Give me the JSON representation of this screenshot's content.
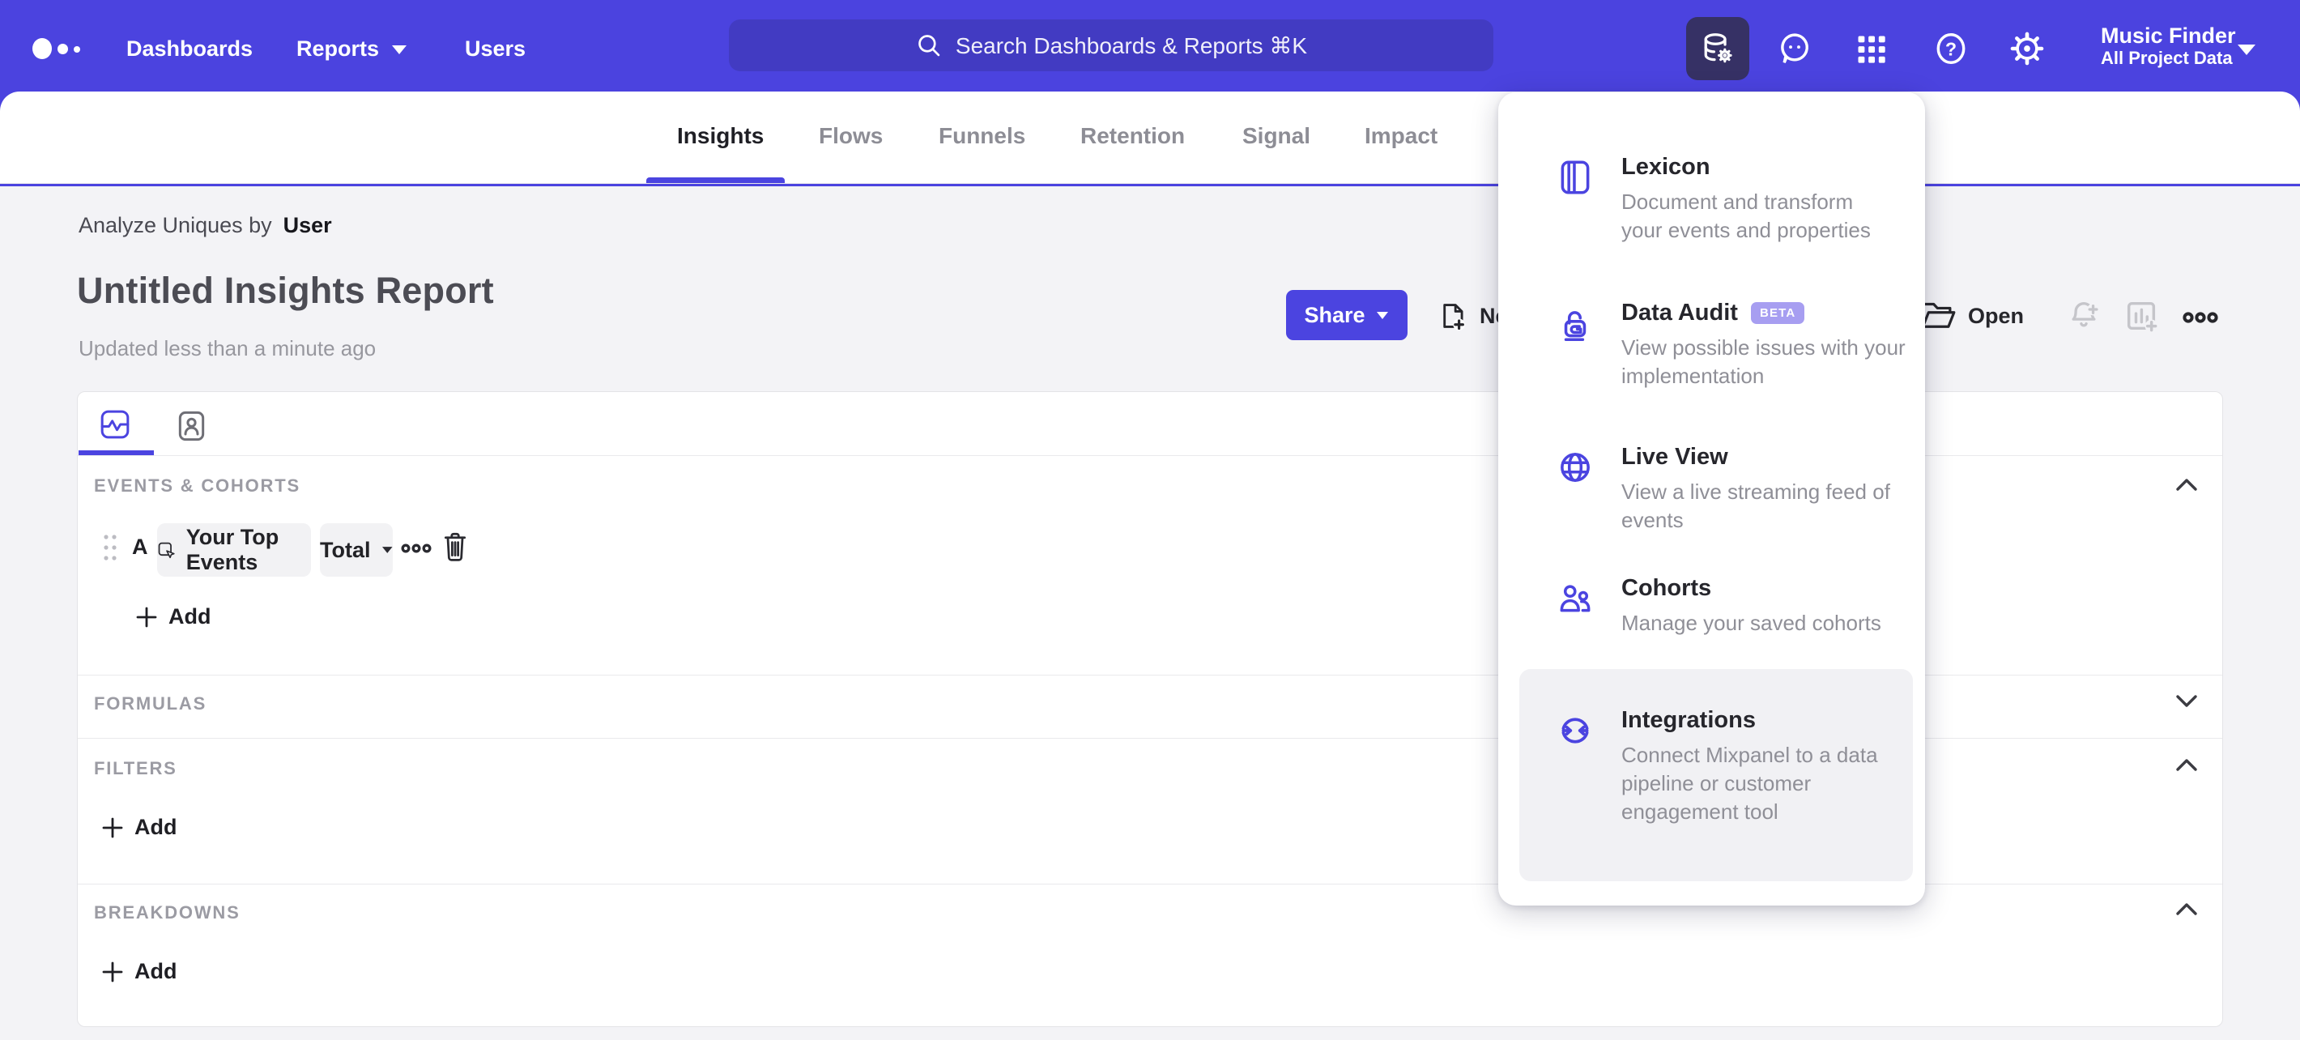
{
  "colors": {
    "accent": "#4b44e0",
    "header_bg": "#4b43df",
    "search_bg": "#423bc2",
    "active_icon_bg": "#363165",
    "beta_bg": "#a79ef1",
    "highlight_bg": "#f1f1f4",
    "muted_icon": "#c5c5ca"
  },
  "header": {
    "nav": [
      {
        "label": "Dashboards"
      },
      {
        "label": "Reports"
      },
      {
        "label": "Users"
      }
    ],
    "search_placeholder": "Search Dashboards & Reports ⌘K",
    "project": {
      "name": "Music Finder",
      "scope": "All Project Data"
    }
  },
  "tabs": [
    {
      "label": "Insights"
    },
    {
      "label": "Flows"
    },
    {
      "label": "Funnels"
    },
    {
      "label": "Retention"
    },
    {
      "label": "Signal"
    },
    {
      "label": "Impact"
    }
  ],
  "report": {
    "breadcrumb_prefix": "Analyze Uniques by",
    "breadcrumb_value": "User",
    "title": "Untitled Insights Report",
    "updated": "Updated less than a minute ago",
    "share_label": "Share",
    "new_label": "New",
    "open_label": "Open"
  },
  "query": {
    "events_label": "EVENTS & COHORTS",
    "row": {
      "letter": "A",
      "event": "Your Top Events",
      "metric": "Total"
    },
    "add_label": "Add",
    "formulas_label": "FORMULAS",
    "filters_label": "FILTERS",
    "breakdowns_label": "BREAKDOWNS"
  },
  "menu": {
    "items": [
      {
        "title": "Lexicon",
        "desc": "Document and transform\nyour events and properties"
      },
      {
        "title": "Data Audit",
        "badge": "BETA",
        "desc": "View possible issues with your\nimplementation"
      },
      {
        "title": "Live View",
        "desc": "View a live streaming feed of\nevents"
      },
      {
        "title": "Cohorts",
        "desc": "Manage your saved cohorts"
      },
      {
        "title": "Integrations",
        "desc": "Connect Mixpanel to a data\npipeline or customer\nengagement tool"
      }
    ]
  }
}
